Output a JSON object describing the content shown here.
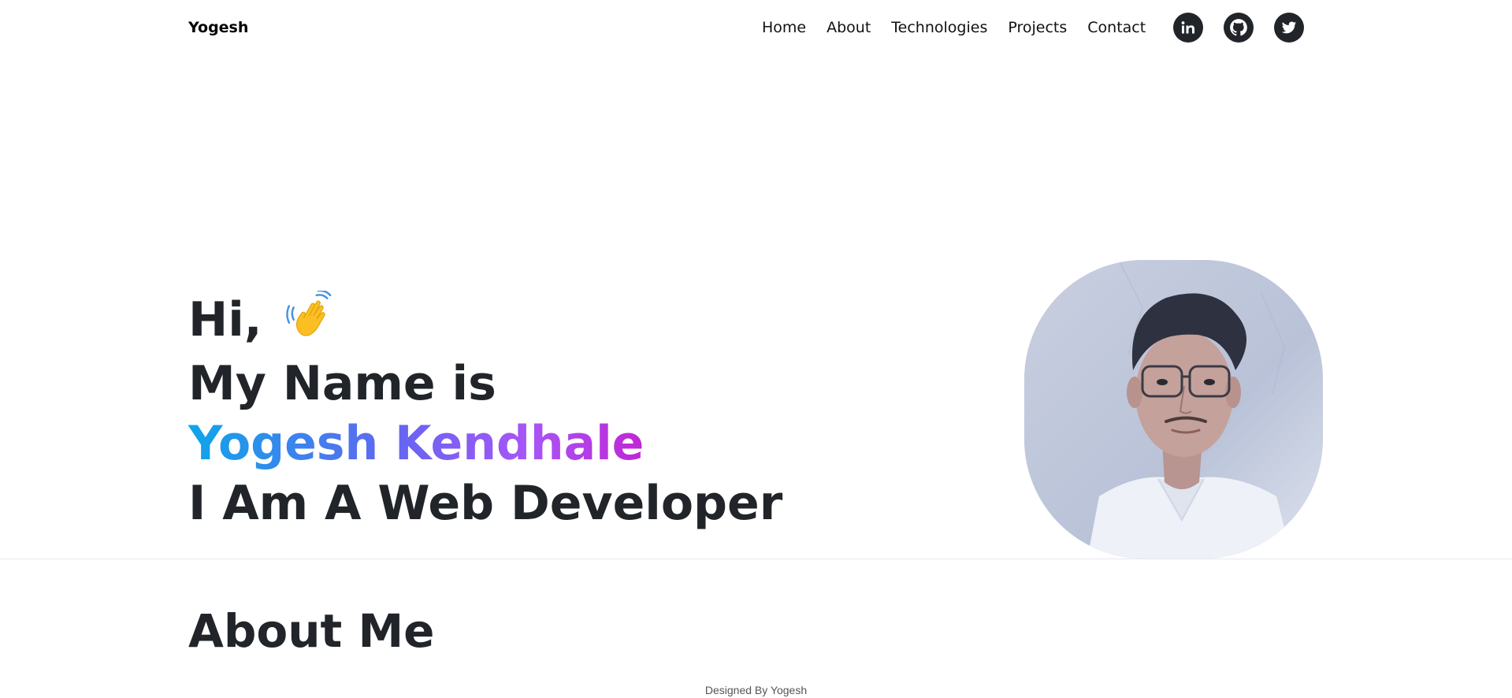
{
  "navbar": {
    "brand": "Yogesh",
    "links": [
      "Home",
      "About",
      "Technologies",
      "Projects",
      "Contact"
    ],
    "socials": [
      {
        "name": "linkedin-icon"
      },
      {
        "name": "github-icon"
      },
      {
        "name": "twitter-icon"
      }
    ]
  },
  "hero": {
    "greeting": "Hi,",
    "wave_icon": "waving-hand-icon",
    "line2": "My Name is",
    "name": "Yogesh Kendhale",
    "line4": "I Am A Web Developer",
    "name_gradient": [
      "#0ea5e9",
      "#6366f1",
      "#a855f7",
      "#c026d3"
    ]
  },
  "about": {
    "title": "About Me"
  },
  "footer": {
    "text": "Designed By Yogesh"
  }
}
